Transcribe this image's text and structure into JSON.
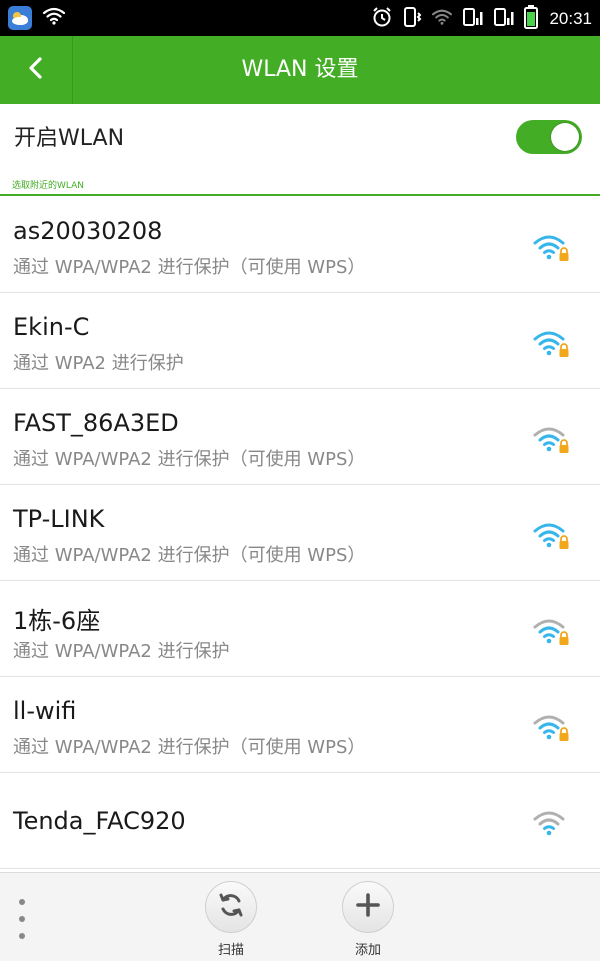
{
  "status_bar": {
    "time": "20:31"
  },
  "header": {
    "title": "WLAN 设置",
    "back_icon": "chevron-left-icon"
  },
  "wlan_toggle": {
    "label": "开启WLAN",
    "enabled": true
  },
  "section_header": "选取附近的WLAN",
  "networks": [
    {
      "ssid": "as20030208",
      "security": "通过 WPA/WPA2 进行保护（可使用 WPS）",
      "signal": 3,
      "locked": true,
      "color": "#36b6ea"
    },
    {
      "ssid": "Ekin-C",
      "security": "通过 WPA2 进行保护",
      "signal": 3,
      "locked": true,
      "color": "#36b6ea"
    },
    {
      "ssid": "FAST_86A3ED",
      "security": "通过 WPA/WPA2 进行保护（可使用 WPS）",
      "signal": 2,
      "locked": true,
      "color": "#36b6ea"
    },
    {
      "ssid": "TP-LINK",
      "security": "通过 WPA/WPA2 进行保护（可使用 WPS）",
      "signal": 3,
      "locked": true,
      "color": "#36b6ea"
    },
    {
      "ssid": "1栋-6座",
      "security": "通过 WPA/WPA2 进行保护",
      "signal": 2,
      "locked": true,
      "color": "#36b6ea"
    },
    {
      "ssid": "ll-wifi",
      "security": "通过 WPA/WPA2 进行保护（可使用 WPS）",
      "signal": 2,
      "locked": true,
      "color": "#36b6ea"
    },
    {
      "ssid": "Tenda_FAC920",
      "security": "",
      "signal": 1,
      "locked": false,
      "color": "#36b6ea"
    }
  ],
  "bottom_bar": {
    "scan_label": "扫描",
    "add_label": "添加"
  },
  "colors": {
    "accent": "#43ad26",
    "wifi_active": "#36b6ea",
    "wifi_inactive": "#b0b0b0",
    "lock": "#f2a81d"
  }
}
